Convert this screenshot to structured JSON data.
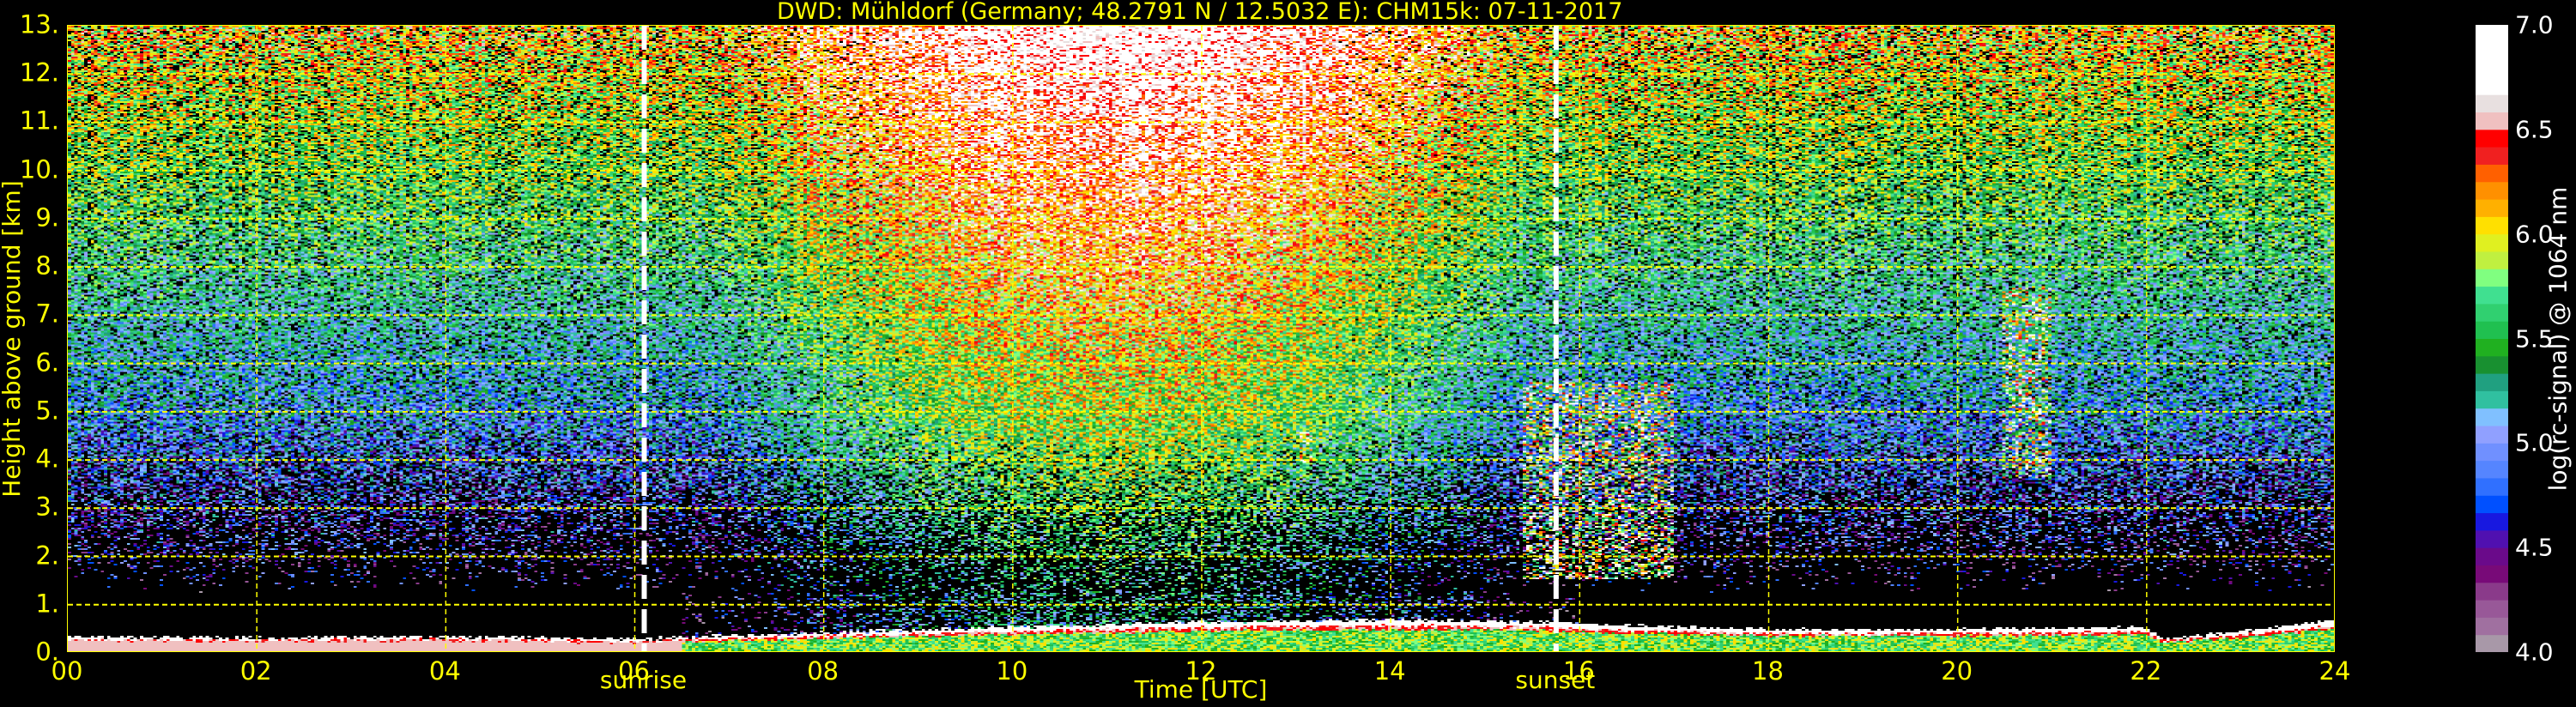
{
  "chart_data": {
    "type": "heatmap",
    "title": "DWD: Mühldorf (Germany; 48.2791 N / 12.5032 E):    CHM15k: 07-11-2017",
    "xlabel": "Time [UTC]",
    "ylabel": "Height above ground [km]",
    "xlim": [
      0,
      24
    ],
    "ylim": [
      0,
      13
    ],
    "grid": true,
    "x_ticks": [
      {
        "value": 0,
        "label": "00"
      },
      {
        "value": 2,
        "label": "02"
      },
      {
        "value": 4,
        "label": "04"
      },
      {
        "value": 6,
        "label": "06"
      },
      {
        "value": 8,
        "label": "08"
      },
      {
        "value": 10,
        "label": "10"
      },
      {
        "value": 12,
        "label": "12"
      },
      {
        "value": 14,
        "label": "14"
      },
      {
        "value": 16,
        "label": "16"
      },
      {
        "value": 18,
        "label": "18"
      },
      {
        "value": 20,
        "label": "20"
      },
      {
        "value": 22,
        "label": "22"
      },
      {
        "value": 24,
        "label": "24"
      }
    ],
    "y_ticks": [
      {
        "value": 0,
        "label": "0."
      },
      {
        "value": 1,
        "label": "1."
      },
      {
        "value": 2,
        "label": "2."
      },
      {
        "value": 3,
        "label": "3."
      },
      {
        "value": 4,
        "label": "4."
      },
      {
        "value": 5,
        "label": "5."
      },
      {
        "value": 6,
        "label": "6."
      },
      {
        "value": 7,
        "label": "7."
      },
      {
        "value": 8,
        "label": "8."
      },
      {
        "value": 9,
        "label": "9."
      },
      {
        "value": 10,
        "label": "10."
      },
      {
        "value": 11,
        "label": "11."
      },
      {
        "value": 12,
        "label": "12."
      },
      {
        "value": 13,
        "label": "13."
      }
    ],
    "annotations": [
      {
        "label": "sunrise",
        "time": 6.1
      },
      {
        "label": "sunset",
        "time": 15.75
      }
    ],
    "boundary_layer_top_km": [
      [
        0,
        0.3
      ],
      [
        2,
        0.28
      ],
      [
        4,
        0.3
      ],
      [
        6,
        0.25
      ],
      [
        8,
        0.38
      ],
      [
        10,
        0.5
      ],
      [
        12,
        0.6
      ],
      [
        14,
        0.65
      ],
      [
        15.7,
        0.6
      ],
      [
        16.2,
        0.55
      ],
      [
        18,
        0.45
      ],
      [
        20,
        0.45
      ],
      [
        22,
        0.5
      ],
      [
        22.2,
        0.25
      ],
      [
        23,
        0.4
      ],
      [
        24,
        0.65
      ]
    ],
    "clouds": [
      {
        "t0": 15.4,
        "t1": 17.0,
        "h0": 1.5,
        "h1": 5.6
      },
      {
        "t0": 20.5,
        "t1": 21.0,
        "h0": 3.6,
        "h1": 7.6
      },
      {
        "t0": 13.0,
        "t1": 13.2,
        "h0": 3.9,
        "h1": 4.6
      }
    ],
    "colorbar": {
      "label": "log(rc-signal) @ 1064 nm",
      "range": [
        4.0,
        7.0
      ],
      "ticks": [
        "4.0",
        "4.5",
        "5.0",
        "5.5",
        "6.0",
        "6.5",
        "7.0"
      ],
      "colors": [
        "#a898a8",
        "#a070a0",
        "#985898",
        "#8a3a8a",
        "#780a78",
        "#6a0a8a",
        "#5010b0",
        "#1818e0",
        "#0050ff",
        "#3070ff",
        "#5585ff",
        "#7090ff",
        "#90a0ff",
        "#80c0ff",
        "#30c0a0",
        "#20a080",
        "#189030",
        "#20b020",
        "#20c050",
        "#30d070",
        "#40e090",
        "#80ff80",
        "#c0f040",
        "#e0f020",
        "#ffe000",
        "#ffb000",
        "#ff9000",
        "#ff6000",
        "#f02020",
        "#ff0000",
        "#f0c0c0",
        "#e8e0e0",
        "#ffffff",
        "#ffffff",
        "#ffffff",
        "#ffffff"
      ]
    }
  }
}
